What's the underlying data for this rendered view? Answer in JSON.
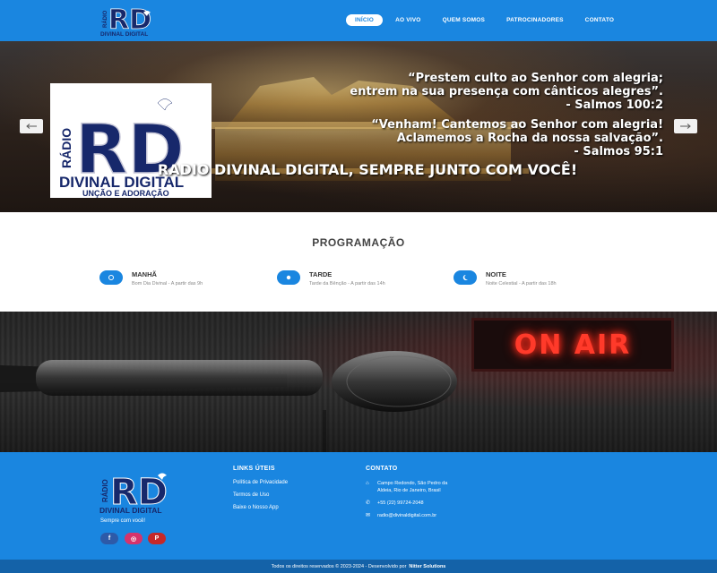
{
  "header": {
    "logo": {
      "badge": "RÁDIO",
      "monogram": "RD",
      "name": "DIVINAL DIGITAL"
    },
    "nav": [
      {
        "label": "INÍCIO",
        "active": true
      },
      {
        "label": "AO VIVO",
        "active": false
      },
      {
        "label": "QUEM SOMOS",
        "active": false
      },
      {
        "label": "PATROCINADORES",
        "active": false
      },
      {
        "label": "CONTATO",
        "active": false
      }
    ]
  },
  "hero": {
    "logo": {
      "badge": "RÁDIO",
      "monogram": "RD",
      "name": "DIVINAL DIGITAL",
      "subtitle": "UNÇÃO E ADORAÇÃO"
    },
    "quote1": [
      "“Prestem culto ao Senhor com alegria;",
      "entrem na sua presença com cânticos alegres”.",
      "- Salmos 100:2"
    ],
    "quote2": [
      "“Venham! Cantemos ao Senhor com alegria!",
      "Aclamemos a Rocha da nossa salvação”.",
      "- Salmos 95:1"
    ],
    "tagline": "RADIO DIVINAL DIGITAL, SEMPRE JUNTO COM VOCÊ!",
    "prev_icon": "arrow-left-icon",
    "next_icon": "arrow-right-icon"
  },
  "programming": {
    "title": "PROGRAMAÇÃO",
    "items": [
      {
        "name": "MANHÃ",
        "desc": "Bom Dia Divinal - A partir das 9h",
        "icon": "sunrise-icon"
      },
      {
        "name": "TARDE",
        "desc": "Tarde da Bênção - A partir das 14h",
        "icon": "sun-icon"
      },
      {
        "name": "NOITE",
        "desc": "Noite Celestial - A partir das 18h",
        "icon": "moon-icon"
      }
    ]
  },
  "studio": {
    "sign": "ON AIR"
  },
  "footer": {
    "logo": {
      "badge": "RÁDIO",
      "monogram": "RD",
      "name": "DIVINAL DIGITAL"
    },
    "tagline": "Sempre com você!",
    "social": [
      {
        "icon": "facebook-icon",
        "glyph": "f"
      },
      {
        "icon": "instagram-icon",
        "glyph": "◎"
      },
      {
        "icon": "pinterest-icon",
        "glyph": "P"
      }
    ],
    "links_title": "LINKS ÚTEIS",
    "links": [
      "Política de Privacidade",
      "Termos de Uso",
      "Baixe o Nosso App"
    ],
    "contact_title": "CONTATO",
    "contact": [
      {
        "icon": "home-icon",
        "glyph": "⌂",
        "lines": [
          "Campo Redondo, São Pedro da",
          "Aldeia, Rio de Janeiro, Brasil"
        ]
      },
      {
        "icon": "phone-icon",
        "glyph": "✆",
        "lines": [
          "+55 (22) 99724-2048"
        ]
      },
      {
        "icon": "email-icon",
        "glyph": "✉",
        "lines": [
          "radio@divinaldigital.com.br"
        ]
      }
    ]
  },
  "bottom_bar": {
    "text": "Todos os direitos reservados © 2023-2024 - Desenvolvido por",
    "developer": "Nitter Solutions"
  },
  "colors": {
    "primary": "#1a86e0",
    "primary_dark": "#1462a8",
    "logo_navy": "#17286b",
    "on_air_red": "#ff3a2a"
  }
}
